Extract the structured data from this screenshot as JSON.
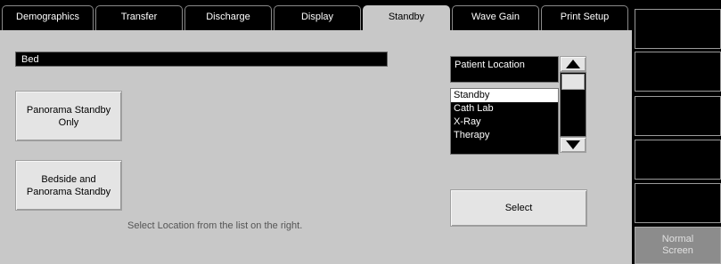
{
  "tabs": [
    {
      "label": "Demographics",
      "active": false
    },
    {
      "label": "Transfer",
      "active": false
    },
    {
      "label": "Discharge",
      "active": false
    },
    {
      "label": "Display",
      "active": false
    },
    {
      "label": "Standby",
      "active": true
    },
    {
      "label": "Wave Gain",
      "active": false
    },
    {
      "label": "Print Setup",
      "active": false
    }
  ],
  "bed_field": {
    "value": "Bed"
  },
  "buttons": {
    "panorama_standby_only": "Panorama Standby\nOnly",
    "bedside_and_panorama": "Bedside and\nPanorama Standby",
    "select": "Select"
  },
  "hint": "Select Location from the list on the right.",
  "patient_location": {
    "header": "Patient Location",
    "items": [
      "Standby",
      "Cath Lab",
      "X-Ray",
      "Therapy"
    ],
    "selected_index": 0
  },
  "icons": {
    "scroll_up": "triangle-up-icon",
    "scroll_down": "triangle-down-icon"
  },
  "sidebar": {
    "buttons": [
      "",
      "",
      "",
      "",
      "",
      "Normal\nScreen"
    ]
  },
  "colors": {
    "panel": "#c8c8c8",
    "tab_inactive": "#000000",
    "button_face": "#e4e4e4",
    "selected_item": "#ffffff",
    "normal_screen_button": "#8c8c8c"
  }
}
